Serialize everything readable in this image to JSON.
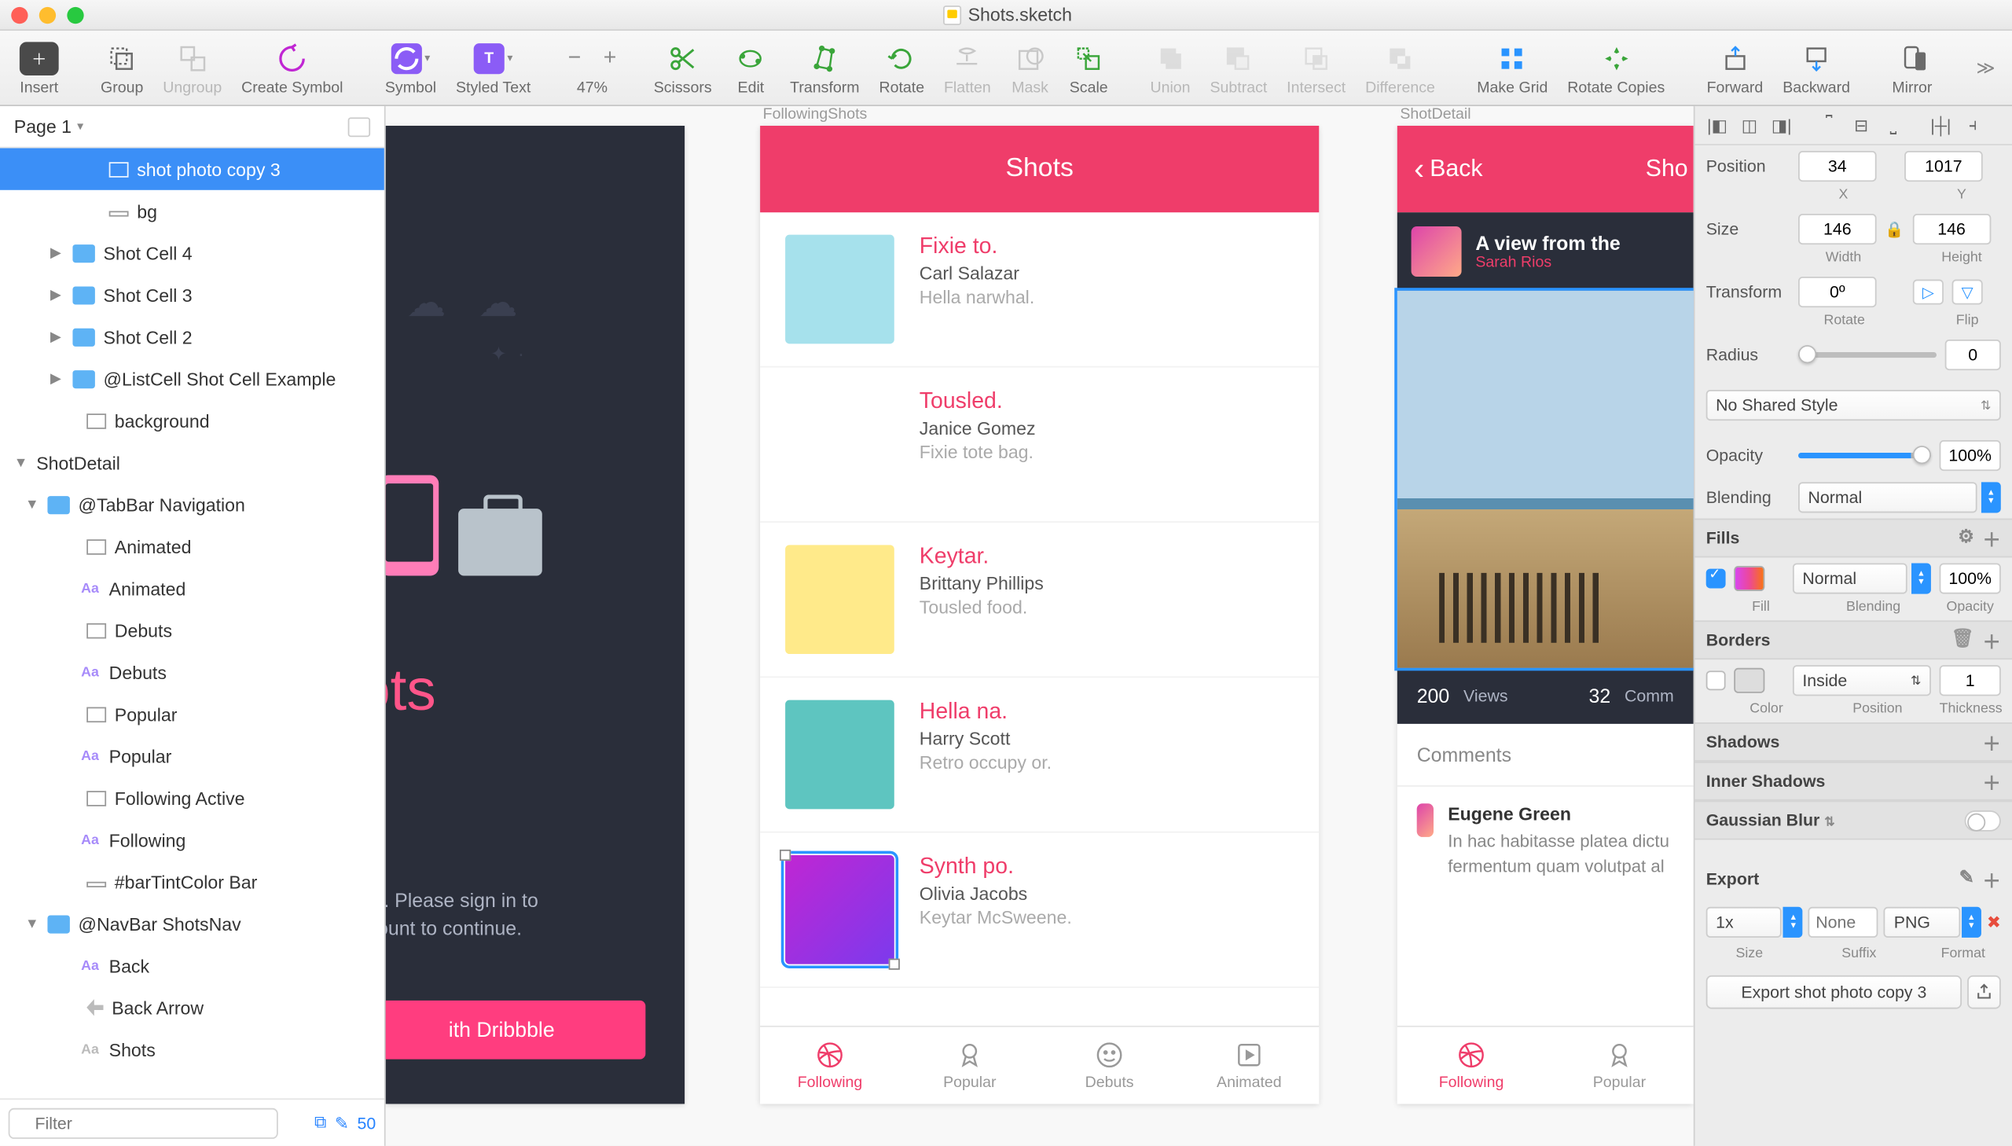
{
  "document_title": "Shots.sketch",
  "toolbar": {
    "insert": "Insert",
    "group": "Group",
    "ungroup": "Ungroup",
    "create_symbol": "Create Symbol",
    "symbol": "Symbol",
    "styled_text": "Styled Text",
    "zoom": "47%",
    "scissors": "Scissors",
    "edit": "Edit",
    "transform": "Transform",
    "rotate": "Rotate",
    "flatten": "Flatten",
    "mask": "Mask",
    "scale": "Scale",
    "union": "Union",
    "subtract": "Subtract",
    "intersect": "Intersect",
    "difference": "Difference",
    "make_grid": "Make Grid",
    "rotate_copies": "Rotate Copies",
    "forward": "Forward",
    "backward": "Backward",
    "mirror": "Mirror"
  },
  "page_selector": "Page 1",
  "layers": {
    "selected": "shot photo copy 3",
    "bg": "bg",
    "cell4": "Shot Cell 4",
    "cell3": "Shot Cell 3",
    "cell2": "Shot Cell 2",
    "listcell": "@ListCell Shot Cell Example",
    "background": "background",
    "shotdetail": "ShotDetail",
    "tabbar": "@TabBar Navigation",
    "animated_l": "Animated",
    "animated_t": "Animated",
    "debuts_l": "Debuts",
    "debuts_t": "Debuts",
    "popular_l": "Popular",
    "popular_t": "Popular",
    "following_active": "Following Active",
    "following_t": "Following",
    "bartint": "#barTintColor Bar",
    "navbar": "@NavBar ShotsNav",
    "back_t": "Back",
    "back_arrow": "Back Arrow",
    "shots_t": "Shots"
  },
  "filter": {
    "placeholder": "Filter",
    "count": "50"
  },
  "artboard_labels": {
    "a1": "",
    "a2": "FollowingShots",
    "a3": "ShotDetail"
  },
  "ab1": {
    "title": "ots",
    "subtitle": "ots. Please sign in to\nccount to continue.",
    "button": "ith Dribbble"
  },
  "ab2": {
    "header": "Shots",
    "shots": [
      {
        "title": "Fixie to.",
        "author": "Carl Salazar",
        "desc": "Hella narwhal.",
        "bg": "#a6e1ec"
      },
      {
        "title": "Tousled.",
        "author": "Janice Gomez",
        "desc": "Fixie tote bag.",
        "bg": "#fff"
      },
      {
        "title": "Keytar.",
        "author": "Brittany Phillips",
        "desc": "Tousled food.",
        "bg": "#ffea8a"
      },
      {
        "title": "Hella na.",
        "author": "Harry Scott",
        "desc": "Retro occupy or.",
        "bg": "#5ec5c0"
      },
      {
        "title": "Synth po.",
        "author": "Olivia Jacobs",
        "desc": "Keytar McSweene.",
        "bg": "linear-gradient(135deg,#c026d3,#7c3aed)"
      }
    ],
    "tabs": {
      "following": "Following",
      "popular": "Popular",
      "debuts": "Debuts",
      "animated": "Animated"
    }
  },
  "ab3": {
    "back": "Back",
    "nav_title": "Sho",
    "shot_title": "A view from the",
    "author": "Sarah Rios",
    "views_n": "200",
    "views_l": "Views",
    "comments_n": "32",
    "comments_l": "Comm",
    "comments_header": "Comments",
    "commenter": "Eugene Green",
    "comment_text": "In hac habitasse platea dictu fermentum quam volutpat al",
    "tabs": {
      "following": "Following",
      "popular": "Popular"
    }
  },
  "inspector": {
    "position_l": "Position",
    "x": "34",
    "y": "1017",
    "x_l": "X",
    "y_l": "Y",
    "size_l": "Size",
    "w": "146",
    "h": "146",
    "w_l": "Width",
    "h_l": "Height",
    "transform_l": "Transform",
    "rotate": "0º",
    "rotate_l": "Rotate",
    "flip_l": "Flip",
    "radius_l": "Radius",
    "radius": "0",
    "shared_style": "No Shared Style",
    "opacity_l": "Opacity",
    "opacity": "100%",
    "blending_l": "Blending",
    "blending": "Normal",
    "fills_l": "Fills",
    "fill_blend": "Normal",
    "fill_opacity": "100%",
    "fill_l": "Fill",
    "fill_blend_l": "Blending",
    "fill_op_l": "Opacity",
    "borders_l": "Borders",
    "border_pos": "Inside",
    "border_thick": "1",
    "color_l": "Color",
    "pos_l": "Position",
    "thick_l": "Thickness",
    "shadows_l": "Shadows",
    "inner_shadows_l": "Inner Shadows",
    "gaussian_l": "Gaussian Blur",
    "export_l": "Export",
    "size": "1x",
    "suffix_ph": "None",
    "format": "PNG",
    "size_l2": "Size",
    "suffix_l": "Suffix",
    "format_l": "Format",
    "export_btn": "Export shot photo copy 3"
  }
}
